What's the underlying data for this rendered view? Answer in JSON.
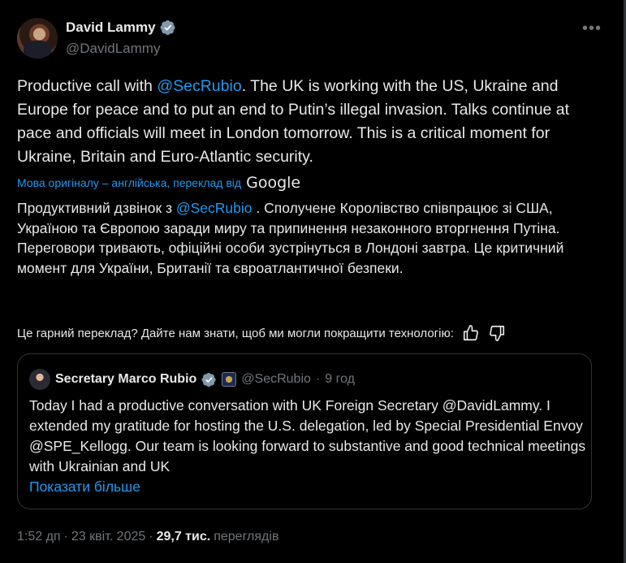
{
  "author": {
    "name": "David Lammy",
    "handle": "@DavidLammy"
  },
  "tweet": {
    "text_before": "Productive call with ",
    "mention": "@SecRubio",
    "text_after": ". The UK is working with the US, Ukraine and Europe for peace and to put an end to Putin’s illegal invasion. Talks continue at pace and officials will meet in London tomorrow. This is a critical moment for Ukraine, Britain and Euro-Atlantic security."
  },
  "translation": {
    "note": "Мова оригіналу – англійська, переклад від",
    "provider": "Google",
    "text_before": "Продуктивний дзвінок з ",
    "mention": "@SecRubio",
    "text_after": " . Сполучене Королівство співпрацює зі США, Україною та Європою заради миру та припинення незаконного вторгнення Путіна. Переговори тривають, офіційні особи зустрінуться в Лондоні завтра. Це критичний момент для України, Британії та євроатлантичної безпеки.",
    "feedback": "Це гарний переклад? Дайте нам знати, щоб ми могли покращити технологію:"
  },
  "quote": {
    "name": "Secretary Marco Rubio",
    "handle": "@SecRubio",
    "separator": "·",
    "time": "9 год",
    "text": "Today I had a productive conversation with UK Foreign Secretary @DavidLammy. I extended my gratitude for hosting the U.S. delegation, led by Special Presidential Envoy @SPE_Kellogg. Our team is looking forward to substantive and good technical meetings with Ukrainian and UK",
    "show_more": "Показати більше"
  },
  "meta": {
    "time": "1:52 дп",
    "separator": "·",
    "date": "23 квіт. 2025",
    "separator2": "·",
    "views_count": "29,7 тис.",
    "views_label": "переглядів"
  },
  "colors": {
    "background": "#000000",
    "text": "#e7e9ea",
    "muted": "#71767b",
    "link": "#1d9bf0",
    "border": "#2f3336"
  },
  "icons": {
    "verified": "verified-badge-icon",
    "more": "more-options-icon",
    "thumb_up": "thumbs-up-icon",
    "thumb_down": "thumbs-down-icon",
    "seal": "government-seal-icon"
  }
}
